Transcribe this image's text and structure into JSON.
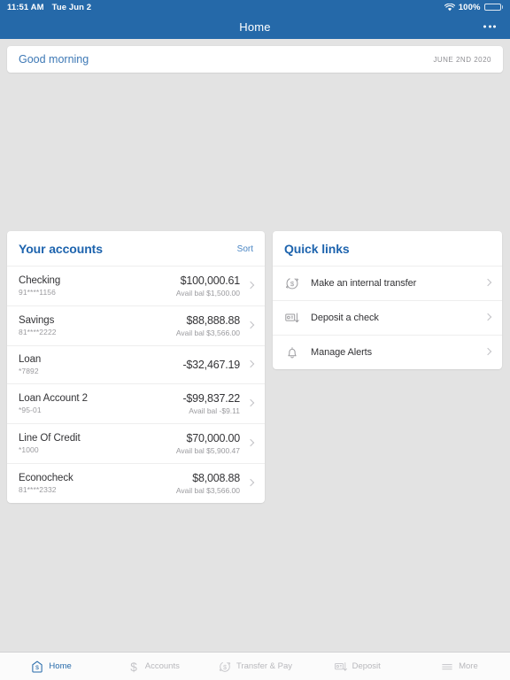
{
  "status_bar": {
    "time": "11:51 AM",
    "date": "Tue Jun 2",
    "wifi_icon": "wifi-icon",
    "battery_percent": "100%",
    "battery_icon": "battery-full-icon"
  },
  "nav": {
    "title": "Home",
    "more_icon": "overflow-menu-icon"
  },
  "greeting": {
    "text": "Good morning",
    "date": "JUNE 2ND 2020"
  },
  "accounts": {
    "title": "Your accounts",
    "sort_label": "Sort",
    "rows": [
      {
        "name": "Checking",
        "number": "91****1156",
        "balance": "$100,000.61",
        "avail": "Avail bal $1,500.00"
      },
      {
        "name": "Savings",
        "number": "81****2222",
        "balance": "$88,888.88",
        "avail": "Avail bal $3,566.00"
      },
      {
        "name": "Loan",
        "number": "*7892",
        "balance": "-$32,467.19",
        "avail": ""
      },
      {
        "name": "Loan Account 2",
        "number": "*95-01",
        "balance": "-$99,837.22",
        "avail": "Avail bal -$9.11"
      },
      {
        "name": "Line Of Credit",
        "number": "*1000",
        "balance": "$70,000.00",
        "avail": "Avail bal $5,900.47"
      },
      {
        "name": "Econocheck",
        "number": "81****2332",
        "balance": "$8,008.88",
        "avail": "Avail bal $3,566.00"
      }
    ]
  },
  "quick_links": {
    "title": "Quick links",
    "rows": [
      {
        "label": "Make an internal transfer",
        "icon": "transfer-dollar-icon"
      },
      {
        "label": "Deposit a check",
        "icon": "deposit-check-icon"
      },
      {
        "label": "Manage Alerts",
        "icon": "bell-icon"
      }
    ]
  },
  "tab_bar": {
    "tabs": [
      {
        "label": "Home",
        "icon": "home-dollar-icon",
        "active": true
      },
      {
        "label": "Accounts",
        "icon": "dollar-sign-icon",
        "active": false
      },
      {
        "label": "Transfer & Pay",
        "icon": "transfer-dollar-icon",
        "active": false
      },
      {
        "label": "Deposit",
        "icon": "deposit-check-icon",
        "active": false
      },
      {
        "label": "More",
        "icon": "hamburger-icon",
        "active": false
      }
    ]
  },
  "colors": {
    "header_blue": "#2569a9",
    "accent_blue": "#1e64ae",
    "link_blue": "#4a86c4",
    "background": "#e3e3e3",
    "card": "#ffffff",
    "muted_text": "#9a9a9e"
  }
}
